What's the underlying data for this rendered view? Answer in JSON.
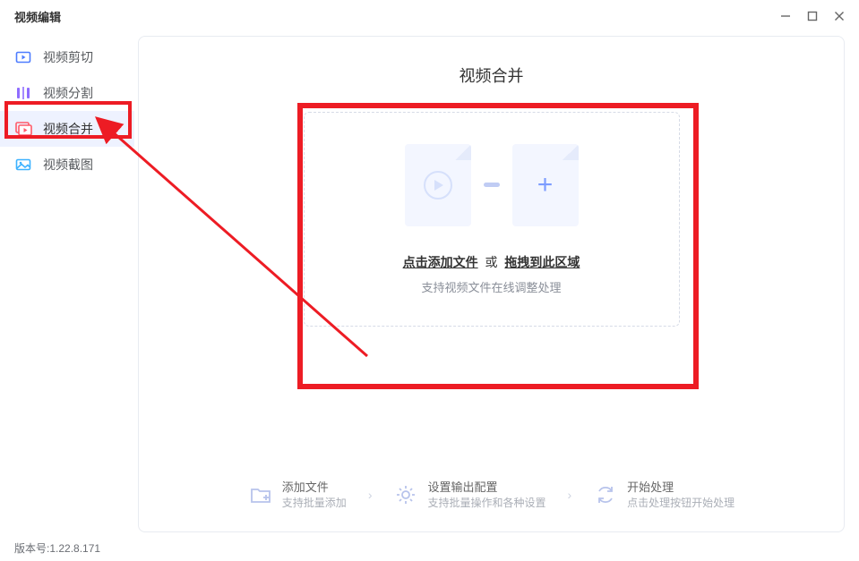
{
  "app": {
    "title": "视频编辑"
  },
  "sidebar": {
    "items": [
      {
        "label": "视频剪切"
      },
      {
        "label": "视频分割"
      },
      {
        "label": "视频合并"
      },
      {
        "label": "视频截图"
      }
    ]
  },
  "main": {
    "title": "视频合并",
    "drop": {
      "click_text": "点击添加文件",
      "or": "或",
      "drag_text": "拖拽到此区域",
      "subtitle": "支持视频文件在线调整处理"
    }
  },
  "steps": [
    {
      "title": "添加文件",
      "sub": "支持批量添加"
    },
    {
      "title": "设置输出配置",
      "sub": "支持批量操作和各种设置"
    },
    {
      "title": "开始处理",
      "sub": "点击处理按钮开始处理"
    }
  ],
  "footer": {
    "version": "版本号:1.22.8.171"
  }
}
